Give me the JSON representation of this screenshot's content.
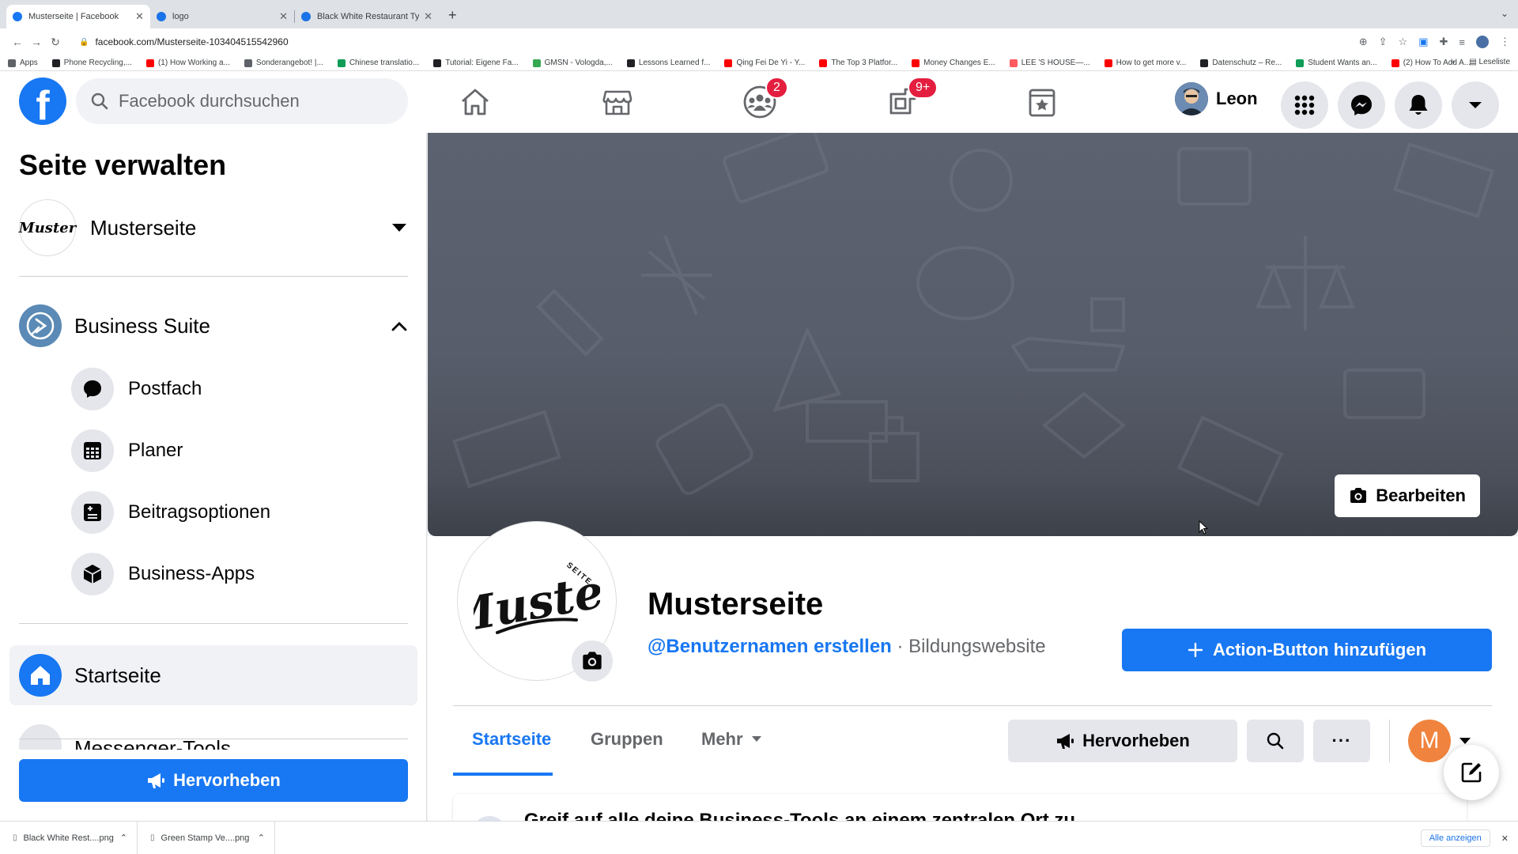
{
  "browser": {
    "tabs": [
      {
        "title": "Musterseite | Facebook",
        "active": true,
        "favicon_color": "#1877f2"
      },
      {
        "title": "logo",
        "active": false,
        "favicon_color": "#1a73e8"
      },
      {
        "title": "Black White Restaurant Typog...",
        "active": false,
        "favicon_color": "#1a73e8"
      }
    ],
    "url": "facebook.com/Musterseite-103404515542960",
    "bookmarks": [
      {
        "label": "Apps",
        "color": "#5f6368"
      },
      {
        "label": "Phone Recycling,...",
        "color": "#202124"
      },
      {
        "label": "(1) How Working a...",
        "color": "#ff0000"
      },
      {
        "label": "Sonderangebot! |...",
        "color": "#5f6368"
      },
      {
        "label": "Chinese translatio...",
        "color": "#0f9d58"
      },
      {
        "label": "Tutorial: Eigene Fa...",
        "color": "#202124"
      },
      {
        "label": "GMSN - Vologda,...",
        "color": "#34a853"
      },
      {
        "label": "Lessons Learned f...",
        "color": "#202124"
      },
      {
        "label": "Qing Fei De Yi - Y...",
        "color": "#ff0000"
      },
      {
        "label": "The Top 3 Platfor...",
        "color": "#ff0000"
      },
      {
        "label": "Money Changes E...",
        "color": "#ff0000"
      },
      {
        "label": "LEE 'S HOUSE—...",
        "color": "#ff5a5f"
      },
      {
        "label": "How to get more v...",
        "color": "#ff0000"
      },
      {
        "label": "Datenschutz – Re...",
        "color": "#202124"
      },
      {
        "label": "Student Wants an...",
        "color": "#0f9d58"
      },
      {
        "label": "(2) How To Add A...",
        "color": "#ff0000"
      }
    ],
    "bookmarks_more": "»",
    "reading_list": "Leseliste"
  },
  "fb": {
    "logo": "f",
    "search_placeholder": "Facebook durchsuchen",
    "badges": {
      "groups": "2",
      "gaming": "9+"
    },
    "user_name": "Leon",
    "accent": "#1877f2"
  },
  "sidebar": {
    "title": "Seite verwalten",
    "page_name": "Musterseite",
    "page_logo_text": "Muster",
    "business_suite": "Business Suite",
    "sub_items": [
      {
        "label": "Postfach",
        "icon": "chat-bubble-icon"
      },
      {
        "label": "Planer",
        "icon": "calendar-grid-icon"
      },
      {
        "label": "Beitragsoptionen",
        "icon": "plus-box-icon"
      },
      {
        "label": "Business-Apps",
        "icon": "cube-icon"
      }
    ],
    "home": "Startseite",
    "messenger_tools": "Messenger-Tools",
    "promote": "Hervorheben"
  },
  "cover": {
    "edit_label": "Bearbeiten"
  },
  "profile": {
    "logo_text": "Muster",
    "logo_small": "SEITE",
    "name": "Musterseite",
    "username_link": "@Benutzernamen erstellen",
    "separator": "·",
    "category": "Bildungswebsite",
    "action_button": "Action-Button hinzufügen",
    "tabs": [
      "Startseite",
      "Gruppen",
      "Mehr"
    ],
    "promote": "Hervorheben",
    "more_dots": "···",
    "account_initial": "M",
    "card_text": "Greif auf alle deine Business-Tools an einem zentralen Ort zu"
  },
  "downloads": {
    "items": [
      "Black White Rest....png",
      "Green Stamp Ve....png"
    ],
    "show_all": "Alle anzeigen"
  }
}
